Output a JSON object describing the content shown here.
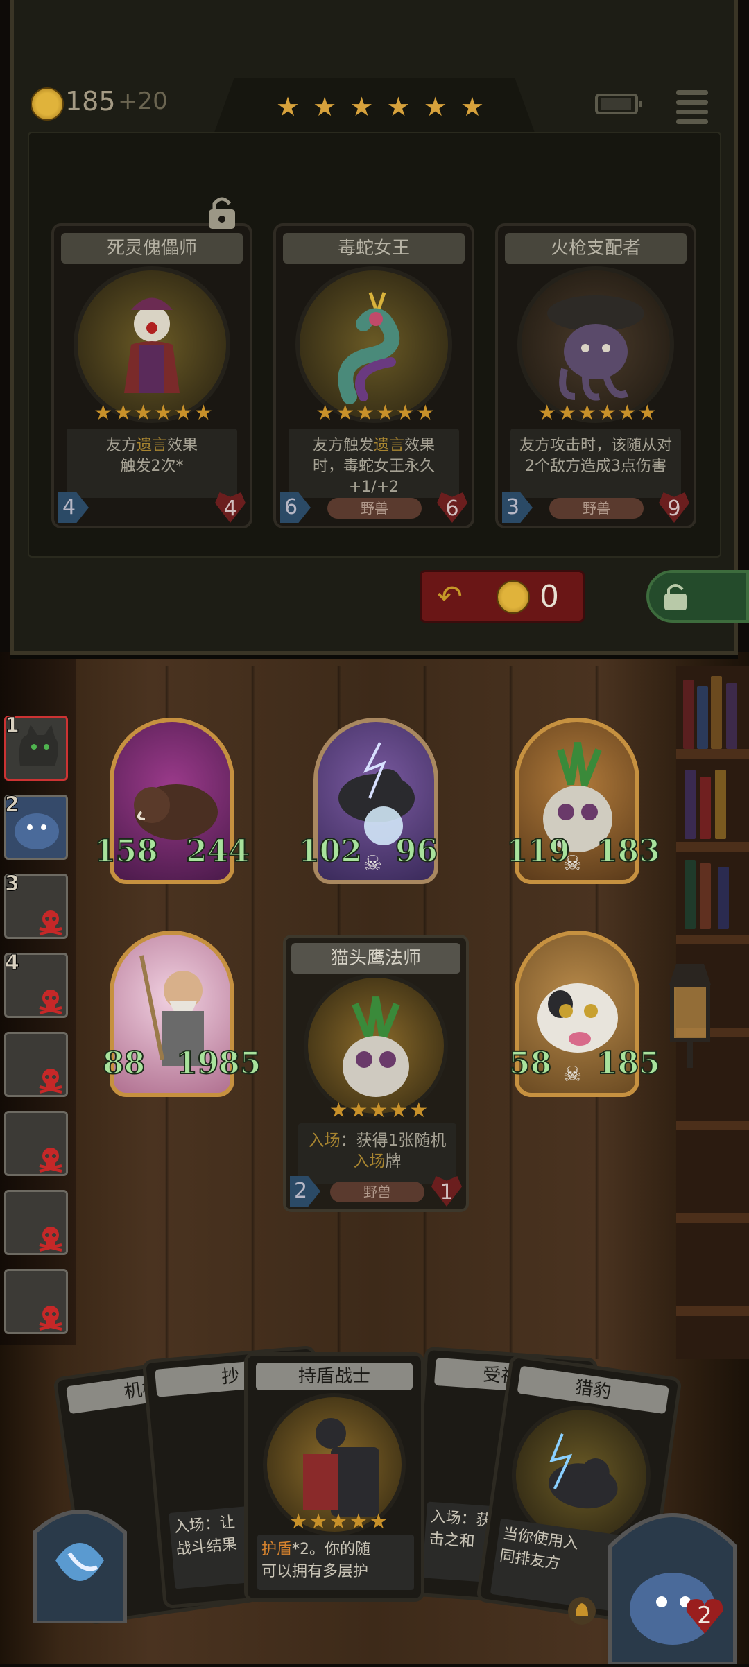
{
  "hud": {
    "gold": "185",
    "gold_income": "+20",
    "tier_stars": [
      "★",
      "★",
      "★",
      "★",
      "★",
      "★"
    ]
  },
  "shop": {
    "cards": [
      {
        "name": "死灵傀儡师",
        "stars": 6,
        "desc_parts": [
          "友方",
          "遗言",
          "效果",
          "触发2次*"
        ],
        "attack": "4",
        "health": "4",
        "tribe": "",
        "locked": true,
        "icon": "puppet-jester-icon"
      },
      {
        "name": "毒蛇女王",
        "stars": 6,
        "desc_parts": [
          "友方触发",
          "遗言",
          "效果",
          "时，毒蛇女王永久+1/+2"
        ],
        "attack": "6",
        "health": "6",
        "tribe": "野兽",
        "locked": false,
        "icon": "serpent-queen-icon"
      },
      {
        "name": "火枪支配者",
        "stars": 6,
        "desc_parts": [
          "友方攻击时，该随从对",
          "",
          "",
          "2个敌方造成3点伤害"
        ],
        "attack": "3",
        "health": "9",
        "tribe": "野兽",
        "locked": false,
        "icon": "octopus-pirate-icon"
      }
    ],
    "reroll_cost": "0"
  },
  "opponents": [
    {
      "rank": "1",
      "eliminated": false,
      "active": true
    },
    {
      "rank": "2",
      "eliminated": false,
      "active": false
    },
    {
      "rank": "3",
      "eliminated": true,
      "active": false
    },
    {
      "rank": "4",
      "eliminated": true,
      "active": false
    },
    {
      "rank": "",
      "eliminated": true,
      "active": false
    },
    {
      "rank": "",
      "eliminated": true,
      "active": false
    },
    {
      "rank": "",
      "eliminated": true,
      "active": false
    },
    {
      "rank": "",
      "eliminated": true,
      "active": false
    }
  ],
  "board": {
    "minions": [
      {
        "attack": "158",
        "health": "244",
        "icon": "boar-icon",
        "frame": "#c69140",
        "bg": "#6b2c63"
      },
      {
        "attack": "102",
        "health": "96",
        "icon": "panther-icon",
        "frame": "#a98860",
        "bg": "#5a3c7a"
      },
      {
        "attack": "119",
        "health": "183",
        "icon": "owl-mage-icon",
        "frame": "#c69140",
        "bg": "#8a5a2a"
      },
      {
        "attack": "88",
        "health": "1985",
        "icon": "warrior-icon",
        "frame": "#c69140",
        "bg": "#d8b3c9"
      },
      {
        "attack": "58",
        "health": "185",
        "icon": "dog-icon",
        "frame": "#c69140",
        "bg": "#9a7138"
      }
    ],
    "inspected_card": {
      "name": "猫头鹰法师",
      "desc_prefix": "入场",
      "desc_mid": "：获得1张随机",
      "desc_highlight": "入场",
      "desc_suffix": "牌",
      "attack": "2",
      "health": "1",
      "tribe": "野兽",
      "stars": 5
    }
  },
  "hand": {
    "cards": [
      {
        "name": "机械",
        "desc": ""
      },
      {
        "name": "抄",
        "desc": "入场：让\n战斗结果"
      },
      {
        "name": "持盾战士",
        "desc_highlight": "护盾",
        "desc": "*2。你的随\n可以拥有多层护"
      },
      {
        "name": "受祝福",
        "desc": "入场：获\n击之和"
      },
      {
        "name": "猎豹",
        "desc": "当你使用入\n同排友方"
      }
    ]
  },
  "player": {
    "health": "2"
  }
}
